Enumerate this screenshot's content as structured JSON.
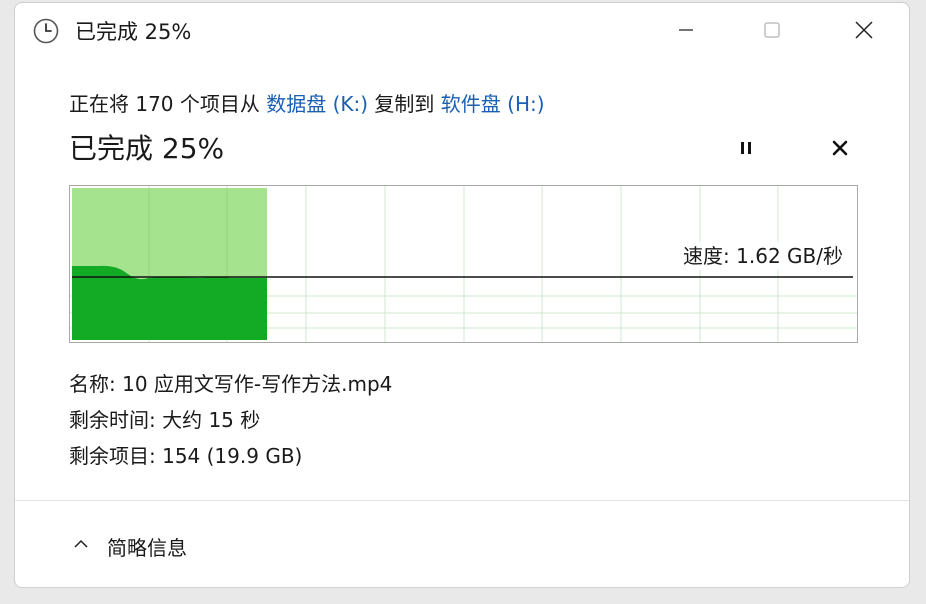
{
  "window": {
    "title": "已完成 25%",
    "minimize_icon": "minimize-icon",
    "maximize_icon": "maximize-icon",
    "close_icon": "close-icon"
  },
  "operation": {
    "prefix": "正在将 170 个项目从 ",
    "source": "数据盘 (K:)",
    "middle": " 复制到 ",
    "destination": "软件盘 (H:)"
  },
  "progress": {
    "heading": "已完成 25%",
    "percent": 25,
    "pause_icon": "pause-icon",
    "cancel_icon": "cancel-icon"
  },
  "graph": {
    "speed_label": "速度: 1.62 GB/秒",
    "progress_fraction": 0.25,
    "colors": {
      "completed_fill": "#a6e38f",
      "speed_fill": "#13ab25",
      "grid": "#cfe8cf",
      "speed_line": "#111111"
    }
  },
  "details": {
    "name": "名称: 10 应用文写作-写作方法.mp4",
    "time_remaining": "剩余时间: 大约 15 秒",
    "items_remaining": "剩余项目: 154 (19.9 GB)"
  },
  "footer": {
    "less_details_label": "简略信息",
    "chevron_icon": "chevron-up-icon"
  }
}
